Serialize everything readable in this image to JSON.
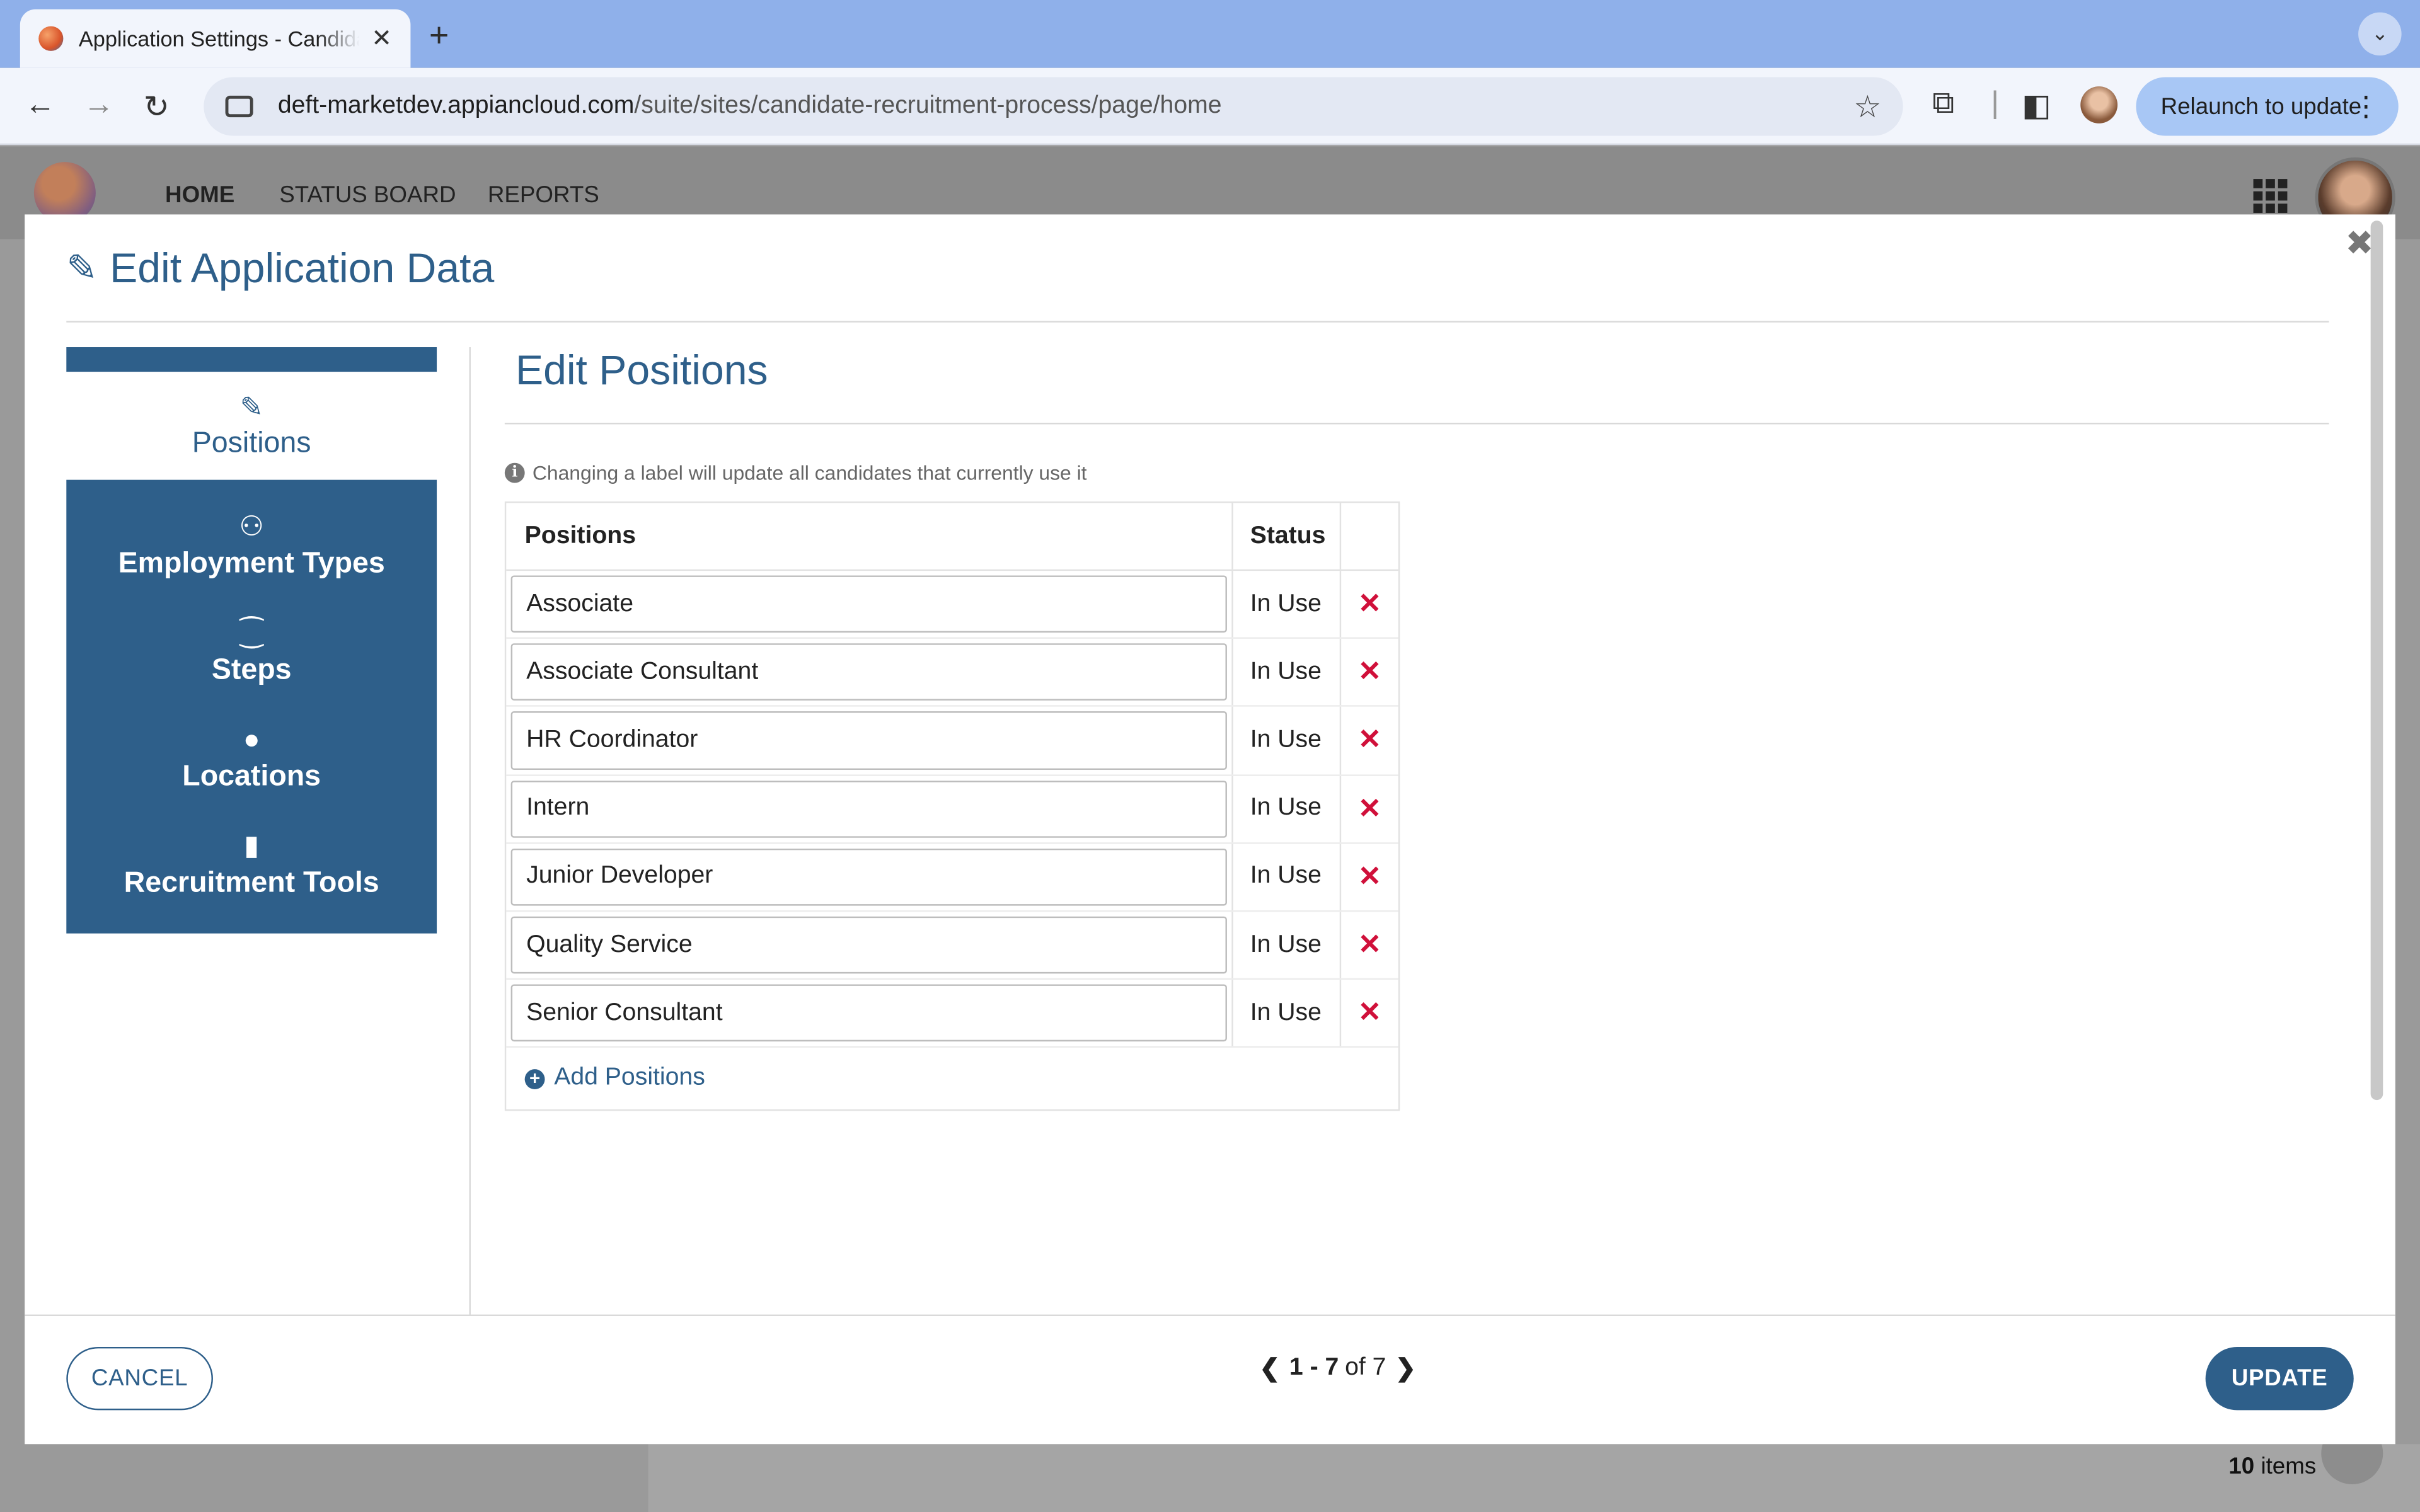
{
  "browser": {
    "tab_title": "Application Settings - Candidate Recruitment Process",
    "url_host": "deft-marketdev.appiancloud.com",
    "url_path": "/suite/sites/candidate-recruitment-process/page/home",
    "relaunch_label": "Relaunch to update"
  },
  "app": {
    "nav": [
      "HOME",
      "STATUS BOARD",
      "REPORTS"
    ],
    "items_count": "10",
    "items_label": "items"
  },
  "modal": {
    "title": "Edit Application Data",
    "sidenav": {
      "active": {
        "label": "Positions",
        "icon": "pencil-icon"
      },
      "items": [
        {
          "label": "Employment Types",
          "icon": "person-icon"
        },
        {
          "label": "Steps",
          "icon": "footsteps-icon"
        },
        {
          "label": "Locations",
          "icon": "globe-icon"
        },
        {
          "label": "Recruitment Tools",
          "icon": "clipboard-icon"
        }
      ]
    },
    "section_title": "Edit Positions",
    "hint": "Changing a label will update all candidates that currently use it",
    "grid": {
      "headers": [
        "Positions",
        "Status",
        ""
      ],
      "rows": [
        {
          "position": "Associate",
          "status": "In Use"
        },
        {
          "position": "Associate Consultant",
          "status": "In Use"
        },
        {
          "position": "HR Coordinator",
          "status": "In Use"
        },
        {
          "position": "Intern",
          "status": "In Use"
        },
        {
          "position": "Junior Developer",
          "status": "In Use"
        },
        {
          "position": "Quality Service",
          "status": "In Use"
        },
        {
          "position": "Senior Consultant",
          "status": "In Use"
        }
      ],
      "add_label": "Add Positions"
    },
    "pager": {
      "range": "1 - 7",
      "of": "of 7"
    },
    "cancel_label": "CANCEL",
    "update_label": "UPDATE"
  },
  "colors": {
    "accent": "#2e5f8a",
    "danger": "#d0103a"
  }
}
